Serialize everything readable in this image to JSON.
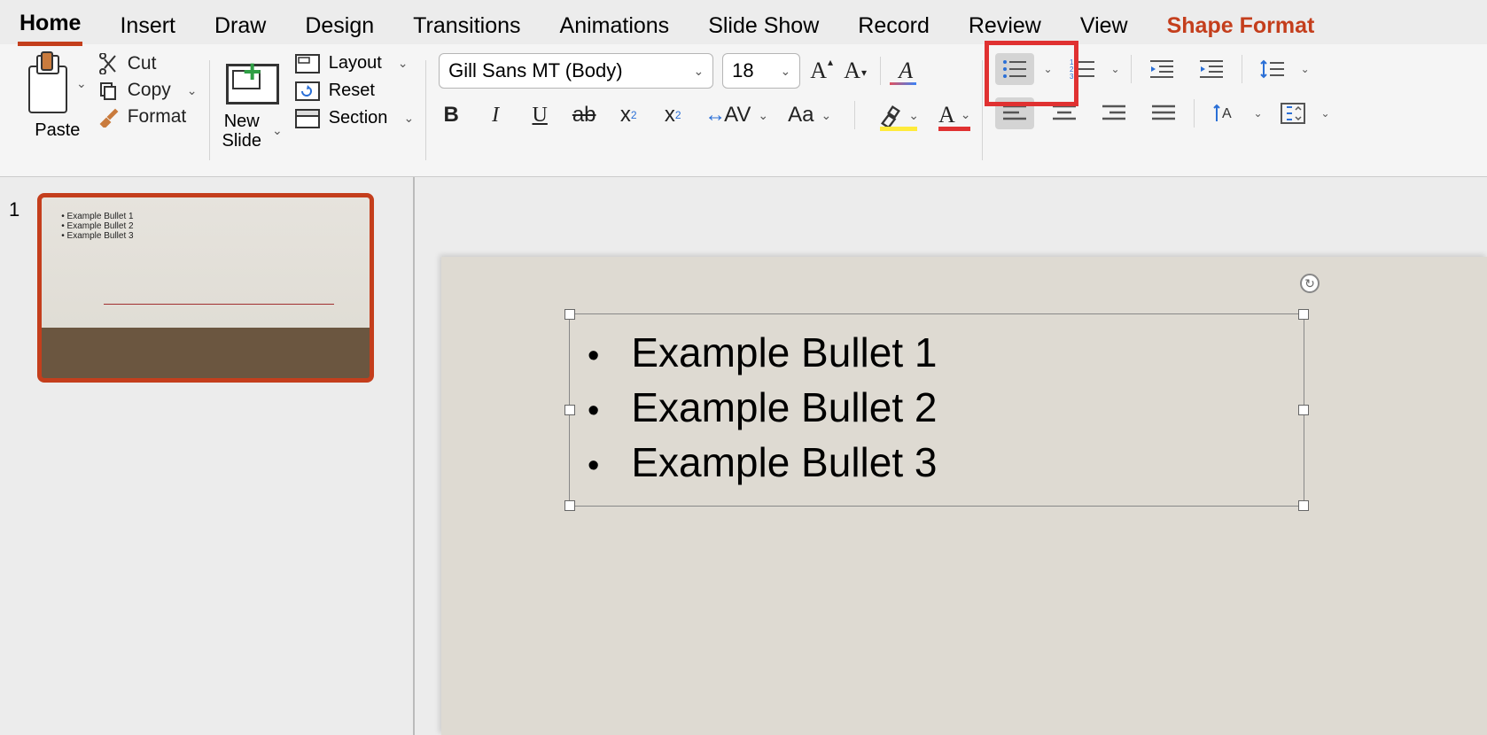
{
  "ribbon": {
    "tabs": [
      "Home",
      "Insert",
      "Draw",
      "Design",
      "Transitions",
      "Animations",
      "Slide Show",
      "Record",
      "Review",
      "View",
      "Shape Format"
    ],
    "active_tab": "Home",
    "context_tab": "Shape Format"
  },
  "clipboard": {
    "paste": "Paste",
    "cut": "Cut",
    "copy": "Copy",
    "format": "Format"
  },
  "slides": {
    "new_slide": "New\nSlide",
    "layout": "Layout",
    "reset": "Reset",
    "section": "Section"
  },
  "font": {
    "name": "Gill Sans MT (Body)",
    "size": "18",
    "bold": "B",
    "italic": "I",
    "underline": "U",
    "strike": "ab",
    "superscript": "x",
    "subscript": "x",
    "spacing": "AV",
    "change_case": "Aa"
  },
  "thumbnail": {
    "number": "1",
    "bullets": [
      "Example Bullet 1",
      "Example Bullet 2",
      "Example Bullet 3"
    ]
  },
  "slide_content": {
    "bullets": [
      "Example Bullet 1",
      "Example Bullet 2",
      "Example Bullet 3"
    ]
  }
}
